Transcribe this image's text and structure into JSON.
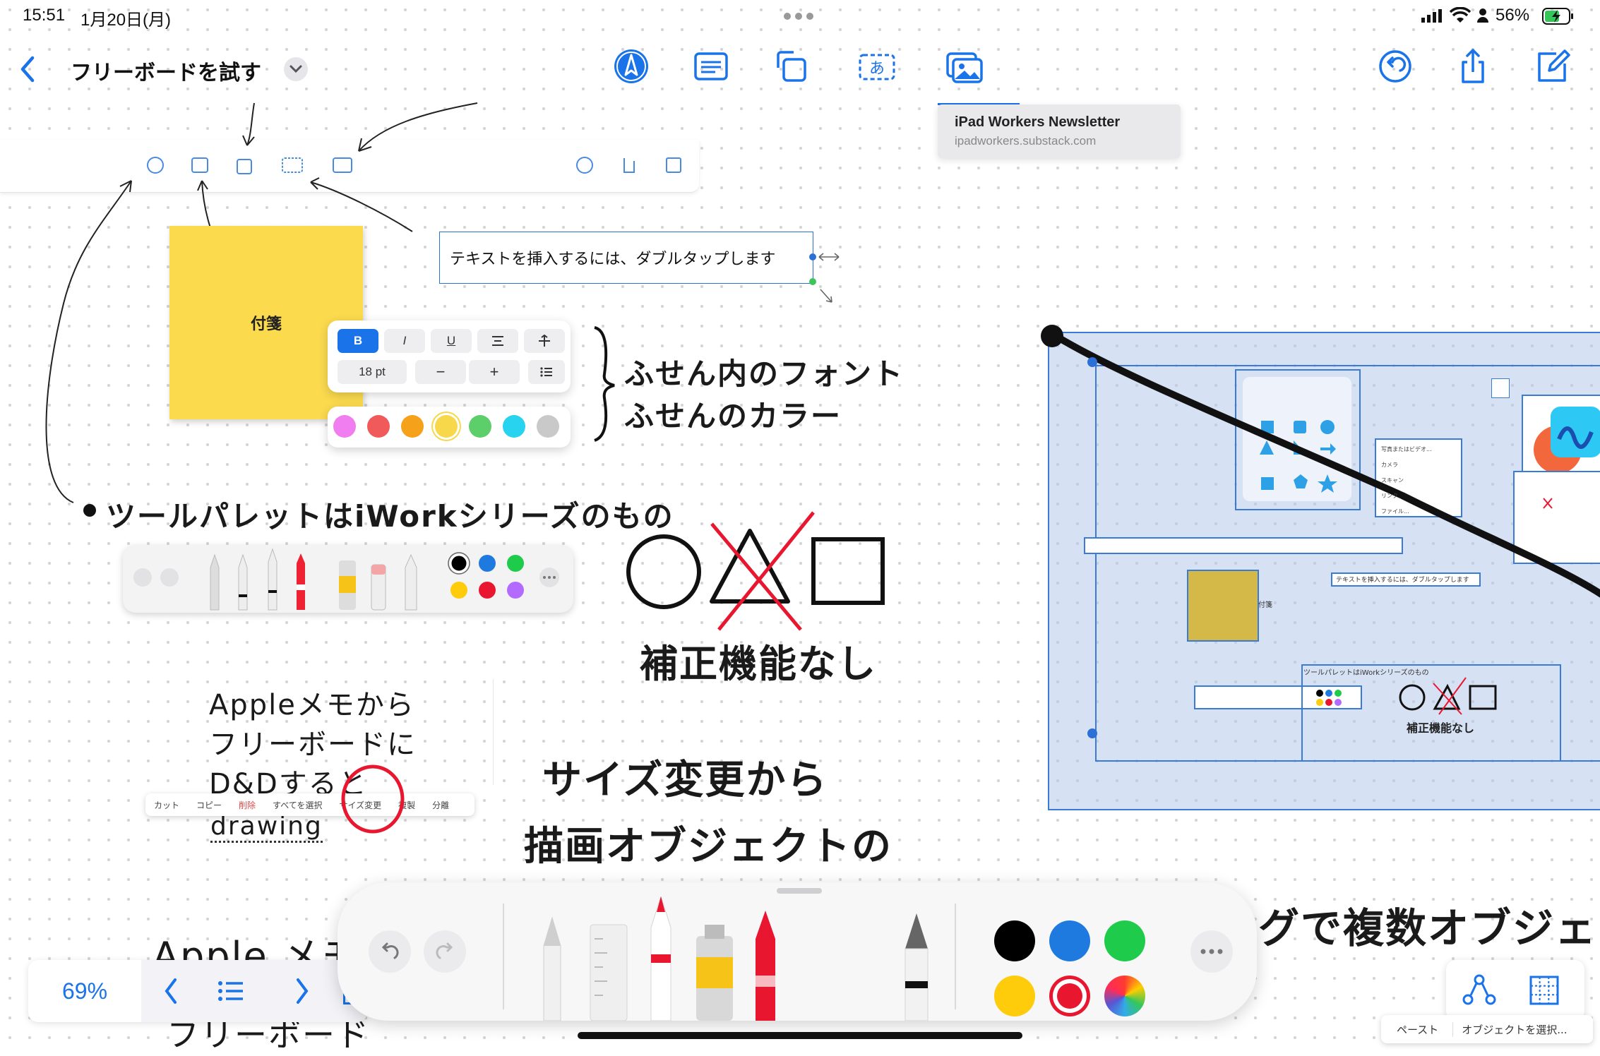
{
  "status_bar": {
    "time": "15:51",
    "date": "1月20日(月)",
    "battery": "56%"
  },
  "header": {
    "board_title": "フリーボードを試す"
  },
  "tooltip": {
    "title": "iPad Workers Newsletter",
    "url": "ipadworkers.substack.com"
  },
  "canvas": {
    "sticky_note_text": "付箋",
    "textbox_text": "テキストを挿入するには、ダブルタップします",
    "format_panel": {
      "bold": "B",
      "italic": "I",
      "underline": "U",
      "font_size": "18 pt",
      "minus": "−",
      "plus": "+",
      "colors": [
        "#f07ef0",
        "#f15a5a",
        "#f6a11a",
        "#f7d84a",
        "#5ccf6b",
        "#27d3ef",
        "#c9c9c9"
      ]
    },
    "handwriting": {
      "annotation_font": "ふせん内のフォント",
      "annotation_color": "ふせんのカラー",
      "tool_palette_note": "ツールパレットはiWorkシリーズのもの",
      "no_correction": "補正機能なし",
      "apple_memo_1": "Appleメモから",
      "apple_memo_2": "フリーボードに",
      "apple_memo_3": "D&Dすると",
      "apple_memo_4": "drawing",
      "resize_1": "サイズ変更から",
      "resize_2": "描画オブジェクトの",
      "multi_obj": "グで複数オブジェ",
      "apple_bottom": "Apple メモ",
      "freeboard_bottom": "フリーボード"
    },
    "context_menu": [
      "カット",
      "コピー",
      "削除",
      "すべてを選択",
      "サイズ変更",
      "複製",
      "分離"
    ],
    "mini_scene": {
      "sticky": "付箋",
      "textbox": "テキストを挿入するには、ダブルタップします",
      "note": "ツールパレットはiWorkシリーズのもの",
      "no_correction": "補正機能なし",
      "photo_menu": [
        "写真またはビデオ...",
        "カメラ",
        "スキャン",
        "リンク",
        "ファイル..."
      ]
    }
  },
  "navigator": {
    "zoom": "69%"
  },
  "drawing_palette": {
    "colors": [
      "#000000",
      "#1f7ae0",
      "#1fcb4a",
      "#fecc0a",
      "#e8162f",
      "rainbow"
    ],
    "selected_color": "#e8162f"
  },
  "bottom_menu": {
    "paste": "ペースト",
    "select_objects": "オブジェクトを選択..."
  },
  "icons": {
    "back": "chevron-left-icon",
    "title_menu": "chevron-down-icon",
    "pen": "pen-circle-icon",
    "sticky": "sticky-note-icon",
    "shapes": "shapes-icon",
    "textbox": "textbox-icon",
    "media": "media-icon",
    "undo": "undo-icon",
    "share": "share-icon",
    "new_board": "compose-icon"
  }
}
